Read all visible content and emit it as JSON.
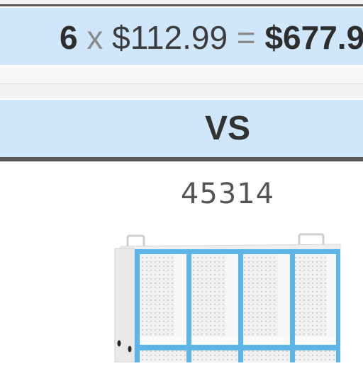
{
  "price": {
    "quantity": "6",
    "times": "x",
    "unit_price": "$112.99",
    "equals": "=",
    "total": "$677.9"
  },
  "compare_label": "VS",
  "product": {
    "sku": "45314",
    "image_icon": "cubby-storage-unit-icon"
  },
  "colors": {
    "bar_bg": "#cfe6fb",
    "frame_border": "#585858",
    "cubby_trim": "#5db4e6"
  }
}
